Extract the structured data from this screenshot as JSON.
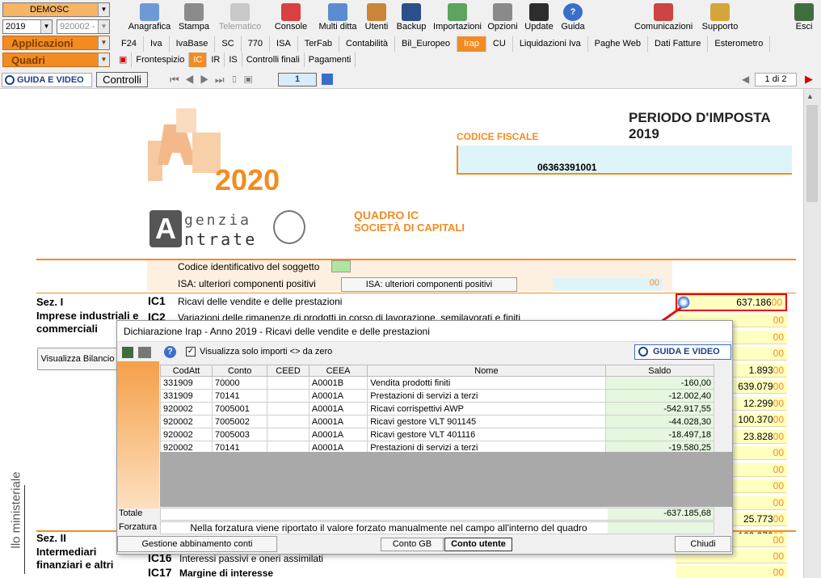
{
  "toolbar": {
    "company": "DEMOSC",
    "year": "2019",
    "code": "920002 -",
    "applicazioni": "Applicazioni",
    "quadri": "Quadri",
    "buttons": [
      "Anagrafica",
      "Stampa",
      "Telematico",
      "Console",
      "Multi ditta",
      "Utenti",
      "Backup",
      "Importazioni",
      "Opzioni",
      "Update",
      "Guida"
    ],
    "right_buttons": [
      "Comunicazioni",
      "Supporto",
      "Esci"
    ]
  },
  "tabs": [
    "F24",
    "Iva",
    "IvaBase",
    "SC",
    "770",
    "ISA",
    "TerFab",
    "Contabilità",
    "Bil_Europeo",
    "Irap",
    "CU",
    "Liquidazioni Iva",
    "Paghe Web",
    "Dati Fatture",
    "Esterometro"
  ],
  "subtabs": [
    "Frontespizio",
    "IC",
    "IR",
    "IS",
    "Controlli finali",
    "Pagamenti"
  ],
  "nav": {
    "guida": "GUIDA E VIDEO",
    "controlli": "Controlli",
    "page_num": "1",
    "page_of": "1 di 2"
  },
  "doc": {
    "periodo": "PERIODO D'IMPOSTA 2019",
    "logo_year": "2020",
    "codice_fiscale_label": "CODICE FISCALE",
    "codice_fiscale": "06363391001",
    "agenzia_line1": "genzia",
    "agenzia_line2": "ntrate",
    "quadro_title": "QUADRO IC",
    "quadro_sub": "SOCIETÀ DI CAPITALI",
    "codice_id": "Codice identificativo del soggetto",
    "isa_label": "ISA: ulteriori componenti positivi",
    "isa_button": "ISA: ulteriori componenti positivi",
    "isa_value": "00",
    "sez1": "Sez. I",
    "sez1_desc": "Imprese industriali e commerciali",
    "ic1_code": "IC1",
    "ic1_desc": "Ricavi delle vendite e delle prestazioni",
    "ic1_value": "637.186",
    "dec": "00",
    "ic2_code": "IC2",
    "ic2_desc": "Variazioni delle rimanenze di prodotti in corso di lavorazione, semilavorati e finiti",
    "visualizza": "Visualizza Bilancio",
    "right_values": [
      "",
      "",
      "",
      "1.893",
      "639.079",
      "12.299",
      "100.370",
      "23.828",
      "",
      "",
      "",
      "",
      "25.773",
      "162.270"
    ],
    "sez2": "Sez. II",
    "sez2_desc": "Intermediari finanziari e altri",
    "ic16_code": "IC16",
    "ic16_desc": "Interessi passivi e oneri assimilati",
    "ic17_code": "IC17",
    "ic17_desc": "Margine di interesse",
    "side_text": "llo ministeriale"
  },
  "dialog": {
    "title": "Dichiarazione Irap - Anno 2019 - Ricavi delle vendite e delle prestazioni",
    "checkbox_label": "Visualizza solo importi <> da zero",
    "guida": "GUIDA E VIDEO",
    "columns": [
      "CodAtt",
      "Conto",
      "CEED",
      "CEEA",
      "Nome",
      "Saldo"
    ],
    "rows": [
      [
        "331909",
        "70000",
        "",
        "A0001B",
        "Vendita prodotti finiti",
        "-160,00"
      ],
      [
        "331909",
        "70141",
        "",
        "A0001A",
        "Prestazioni di servizi a terzi",
        "-12.002,40"
      ],
      [
        "920002",
        "7005001",
        "",
        "A0001A",
        "Ricavi corrispettivi AWP",
        "-542.917,55"
      ],
      [
        "920002",
        "7005002",
        "",
        "A0001A",
        "Ricavi gestore VLT 901145",
        "-44.028,30"
      ],
      [
        "920002",
        "7005003",
        "",
        "A0001A",
        "Ricavi gestore VLT 401116",
        "-18.497,18"
      ],
      [
        "920002",
        "70141",
        "",
        "A0001A",
        "Prestazioni di servizi a terzi",
        "-19.580,25"
      ]
    ],
    "totale_label": "Totale",
    "totale_value": "-637.185,68",
    "forzatura_label": "Forzatura",
    "forzatura_text": "Nella forzatura viene riportato il valore forzato manualmente nel campo all'interno del quadro",
    "btn_gestione": "Gestione abbinamento conti",
    "btn_contogb": "Conto GB",
    "btn_contoutente": "Conto utente",
    "btn_chiudi": "Chiudi"
  }
}
